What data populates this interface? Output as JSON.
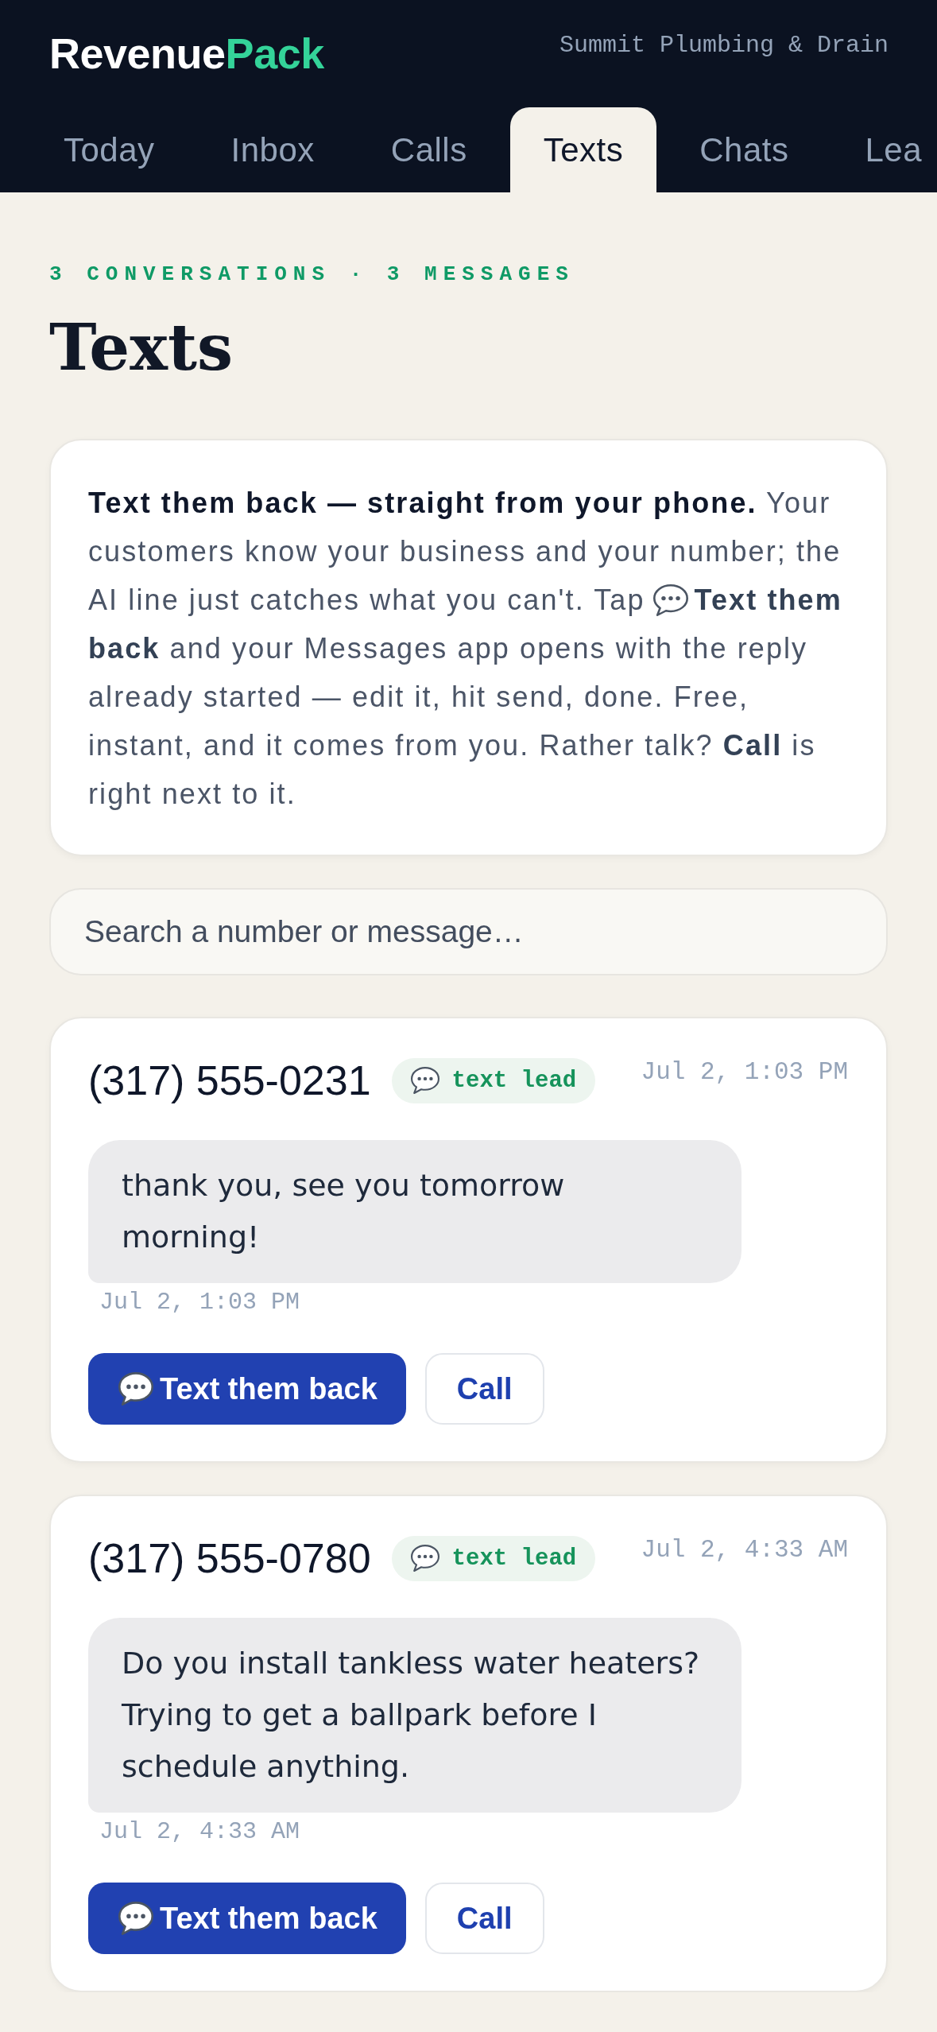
{
  "header": {
    "logo": {
      "primary": "Revenue",
      "accent": "Pack"
    },
    "business_name": "Summit Plumbing & Drain"
  },
  "tabs": [
    {
      "label": "Today",
      "selected": false
    },
    {
      "label": "Inbox",
      "selected": false
    },
    {
      "label": "Calls",
      "selected": false
    },
    {
      "label": "Texts",
      "selected": true
    },
    {
      "label": "Chats",
      "selected": false
    },
    {
      "label": "Lea",
      "selected": false
    }
  ],
  "page": {
    "eyebrow": "3 CONVERSATIONS · 3 MESSAGES",
    "title": "Texts"
  },
  "intro": {
    "text_before_icon": "**Text them back — straight from your phone.** Your customers know your business and your number; the AI line just catches what you can't. Tap",
    "text_after_icon": "**Text them back** and your Messages app opens with the reply already started — edit it, hit send, done. Free, instant, and it comes from you. Rather talk? **Call** is right next to it."
  },
  "search": {
    "placeholder": "Search a number or message…"
  },
  "conversations": [
    {
      "phone": "(317) 555-0231",
      "badge": "text lead",
      "time": "Jul 2, 1:03 PM",
      "messages": [
        {
          "text": "thank you, see you tomorrow morning!",
          "time": "Jul 2, 1:03 PM"
        }
      ],
      "actions": [
        {
          "kind": "primary",
          "label": "Text them back"
        },
        {
          "kind": "secondary",
          "label": "Call"
        }
      ]
    },
    {
      "phone": "(317) 555-0780",
      "badge": "text lead",
      "time": "Jul 2, 4:33 AM",
      "messages": [
        {
          "text": "Do you install tankless water heaters? Trying to get a ballpark before I schedule anything.",
          "time": "Jul 2, 4:33 AM"
        }
      ],
      "actions": [
        {
          "kind": "primary",
          "label": "Text them back"
        },
        {
          "kind": "secondary",
          "label": "Call"
        }
      ]
    }
  ]
}
